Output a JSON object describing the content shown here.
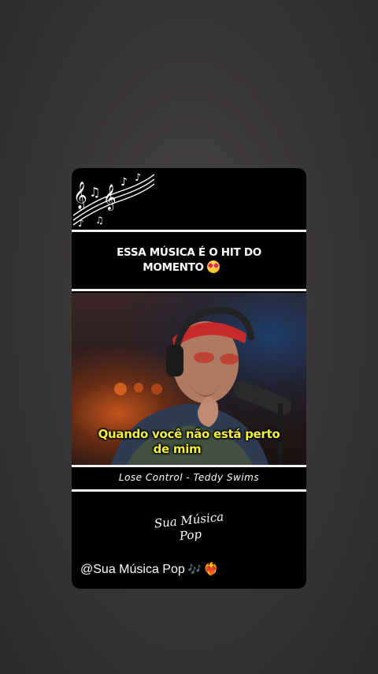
{
  "post": {
    "headline_line1": "ESSA MÚSICA É O HIT DO",
    "headline_line2": "MOMENTO",
    "headline_emoji": "star-struck-emoji",
    "subtitle_line1": "Quando você não está perto",
    "subtitle_line2": "de mim",
    "song_info": "Lose Control - Teddy Swims",
    "logo_line1": "Sua Música",
    "logo_line2": "Pop",
    "handle": "@Sua Música Pop",
    "handle_notes": "🎶",
    "handle_heart": "❤️‍🔥"
  },
  "colors": {
    "card_bg": "#000000",
    "subtitle_color": "#f4f13a",
    "accent_heart": "#e0245e"
  },
  "icons": [
    "music-notes-decoration",
    "star-struck-emoji",
    "music-notes-emoji",
    "heart-on-fire-emoji"
  ]
}
